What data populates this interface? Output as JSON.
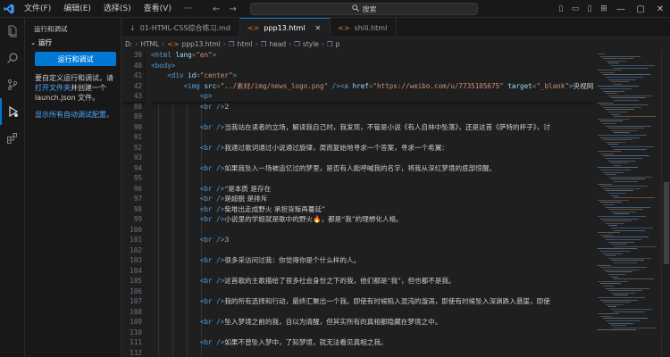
{
  "titlebar": {
    "menu": [
      "文件(F)",
      "编辑(E)",
      "选择(S)",
      "查看(V)",
      "···"
    ],
    "search_placeholder": "搜索"
  },
  "sidebar": {
    "title": "运行和调试",
    "section": "运行",
    "run_button": "运行和调试",
    "info_text_1": "要自定义运行和调试，请",
    "info_link": "打开文件夹",
    "info_text_2": "并创建一个 launch.json 文件。",
    "auto_debug_link": "显示所有自动调试配置。"
  },
  "tabs": [
    {
      "label": "01-HTML-CSS综合练习.md",
      "type": "md",
      "active": false
    },
    {
      "label": "ppp13.html",
      "type": "html",
      "active": true
    },
    {
      "label": "shili.html",
      "type": "html",
      "active": false
    }
  ],
  "breadcrumb": [
    "D:",
    "HTML",
    "ppp13.html",
    "html",
    "head",
    "style",
    "p"
  ],
  "sticky_lines": [
    {
      "n": "39",
      "html": "<span class='tag'>&lt;html</span> <span class='attr'>lang</span><span class='punct'>=</span><span class='str'>\"en\"</span><span class='tag'>&gt;</span>"
    },
    {
      "n": "40",
      "html": "<span class='tag'>&lt;body&gt;</span>"
    },
    {
      "n": "41",
      "html": "    <span class='tag'>&lt;div</span> <span class='attr'>id</span><span class='punct'>=</span><span class='str'>\"center\"</span><span class='tag'>&gt;</span>"
    },
    {
      "n": "42",
      "html": "        <span class='tag'>&lt;img</span> <span class='attr'>src</span><span class='punct'>=</span><span class='str'>\"../素材/img/news_logo.png\"</span> <span class='tag'>/&gt;&lt;a</span> <span class='attr'>href</span><span class='punct'>=</span><span class='str'>\"https://weibo.com/u/7735105675\"</span> <span class='attr'>target</span><span class='punct'>=</span><span class='str'>\"_blank\"</span><span class='tag'>&gt;</span><span class='txt'>央视网</span>"
    },
    {
      "n": "43",
      "html": "            <span class='tag'>&lt;p&gt;</span>"
    }
  ],
  "code_lines": [
    {
      "n": "88",
      "html": "            <span class='tag'>&lt;br /&gt;</span><span class='cn'>2</span>"
    },
    {
      "n": "89",
      "html": ""
    },
    {
      "n": "90",
      "html": "            <span class='tag'>&lt;br /&gt;</span><span class='cn'>当我站在读者的立场，解读我自己时，我发现，不管是小说《有人自林中坠落》，还是这首《萨特的杯子》，讨</span>"
    },
    {
      "n": "91",
      "html": ""
    },
    {
      "n": "92",
      "html": "            <span class='tag'>&lt;br /&gt;</span><span class='cn'>我通过歌词通过小说通过旋律，周而复始地寻求一个答案，寻求一个希翼：</span>"
    },
    {
      "n": "93",
      "html": ""
    },
    {
      "n": "94",
      "html": "            <span class='tag'>&lt;br /&gt;</span><span class='cn'>如果我坠入一场被追忆过的梦里，是否有人能呼喊我的名字，将我从深红梦境的底部惊醒。</span>"
    },
    {
      "n": "95",
      "html": ""
    },
    {
      "n": "96",
      "html": "            <span class='tag'>&lt;br /&gt;</span><span class='cn'>“是本质 是存在</span>"
    },
    {
      "n": "97",
      "html": "            <span class='tag'>&lt;br /&gt;</span><span class='cn'>是超脱 是排斥</span>"
    },
    {
      "n": "98",
      "html": "            <span class='tag'>&lt;br /&gt;</span><span class='cn'>柴堆出走成野火 承担背叛再蔓延”</span>"
    },
    {
      "n": "99",
      "html": "            <span class='tag'>&lt;br /&gt;</span><span class='cn'>小说里的学姐就是歌中的野火🔥，都是“我”的理想化人格。</span>"
    },
    {
      "n": "100",
      "html": ""
    },
    {
      "n": "101",
      "html": "            <span class='tag'>&lt;br /&gt;</span><span class='cn'>3</span>"
    },
    {
      "n": "102",
      "html": ""
    },
    {
      "n": "103",
      "html": "            <span class='tag'>&lt;br /&gt;</span><span class='cn'>很多采访问过我：你觉得你是个什么样的人。</span>"
    },
    {
      "n": "104",
      "html": ""
    },
    {
      "n": "105",
      "html": "            <span class='tag'>&lt;br /&gt;</span><span class='cn'>这首歌的主歌描绘了很多社会身份之下的我，他们都是“我”，但也都不是我。</span>"
    },
    {
      "n": "106",
      "html": ""
    },
    {
      "n": "107",
      "html": "            <span class='tag'>&lt;br /&gt;</span><span class='cn'>我的所有选择和行动，最终汇聚出一个我。即使有时候陷入混沌的漩涡，即使有时候坠入深渊跌入悬崖，即使</span>"
    },
    {
      "n": "108",
      "html": ""
    },
    {
      "n": "109",
      "html": "            <span class='tag'>&lt;br /&gt;</span><span class='cn'>坠入梦境之前的我，自以为清醒，但其实所有的真相都隐藏在梦境之中。</span>"
    },
    {
      "n": "110",
      "html": ""
    },
    {
      "n": "111",
      "html": "            <span class='tag'>&lt;br /&gt;</span><span class='cn'>如果不曾坠入梦中，了知梦境，就无法看见真相之我。</span>"
    },
    {
      "n": "112",
      "html": ""
    }
  ],
  "colors": {
    "accent": "#0078d4",
    "editor_bg": "#1f1f1f",
    "tag": "#569cd6",
    "attr": "#9cdcfe",
    "string": "#ce9178"
  }
}
